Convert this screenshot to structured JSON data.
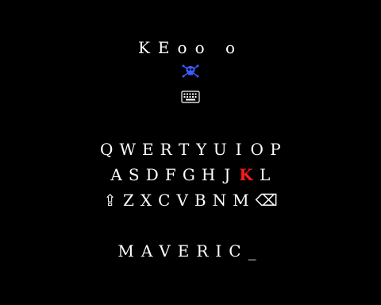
{
  "screen": {
    "title": "KEoo o",
    "icons": [
      "skull-crossbones-icon",
      "keyboard-icon"
    ]
  },
  "keyboard": {
    "rows": [
      [
        {
          "label": "Q"
        },
        {
          "label": "W"
        },
        {
          "label": "E"
        },
        {
          "label": "R"
        },
        {
          "label": "T"
        },
        {
          "label": "Y"
        },
        {
          "label": "U"
        },
        {
          "label": "I"
        },
        {
          "label": "O"
        },
        {
          "label": "P"
        }
      ],
      [
        {
          "label": "A"
        },
        {
          "label": "S"
        },
        {
          "label": "D"
        },
        {
          "label": "F"
        },
        {
          "label": "G"
        },
        {
          "label": "H"
        },
        {
          "label": "J"
        },
        {
          "label": "K"
        },
        {
          "label": "L"
        }
      ],
      [
        {
          "label": "⇪",
          "icon": "shift-icon"
        },
        {
          "label": "Z"
        },
        {
          "label": "X"
        },
        {
          "label": "C"
        },
        {
          "label": "V"
        },
        {
          "label": "B"
        },
        {
          "label": "N"
        },
        {
          "label": "M"
        },
        {
          "label": "⌫",
          "icon": "backspace-icon"
        }
      ]
    ],
    "selected_key": "K"
  },
  "entry": {
    "text": "MAVERIC_"
  },
  "colors": {
    "background": "#000000",
    "text": "#ffffff",
    "selected": "#ff1a1a",
    "skull_icon": "#3b5bff"
  }
}
